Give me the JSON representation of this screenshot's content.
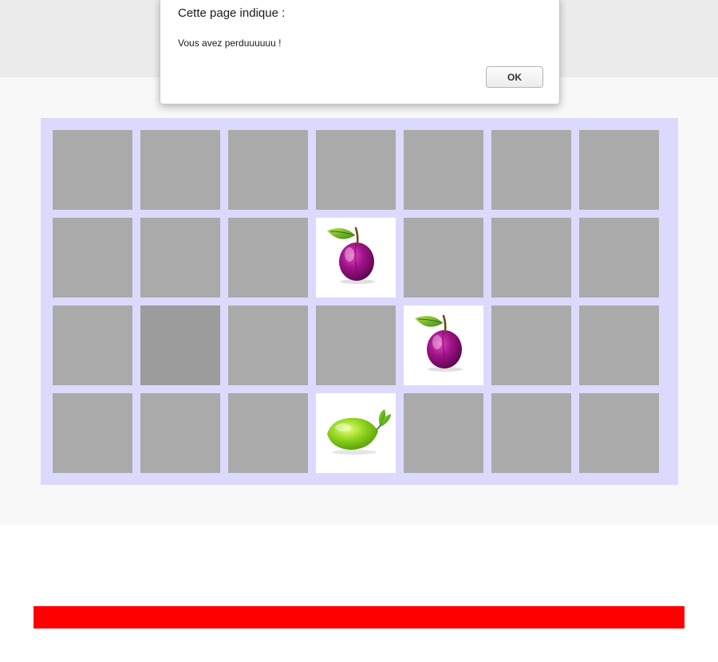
{
  "alert": {
    "title": "Cette page indique :",
    "message": "Vous avez perduuuuuu !",
    "ok_label": "OK"
  },
  "board": {
    "rows": 4,
    "cols": 7,
    "cards": [
      [
        "hidden",
        "hidden",
        "hidden",
        "hidden",
        "hidden",
        "hidden",
        "hidden"
      ],
      [
        "hidden",
        "hidden",
        "hidden",
        "plum",
        "hidden",
        "hidden",
        "hidden"
      ],
      [
        "hidden",
        "hidden-hover",
        "hidden",
        "hidden",
        "plum",
        "hidden",
        "hidden"
      ],
      [
        "hidden",
        "hidden",
        "hidden",
        "lime",
        "hidden",
        "hidden",
        "hidden"
      ]
    ]
  },
  "timer": {
    "fraction_remaining": 1.0,
    "color": "#ff0000"
  },
  "colors": {
    "board_background": "#dcdafc",
    "card_back": "#aaaaaa",
    "card_back_hover": "#9c9c9c"
  },
  "icons": {
    "plum": "plum-icon",
    "lime": "lime-icon"
  }
}
